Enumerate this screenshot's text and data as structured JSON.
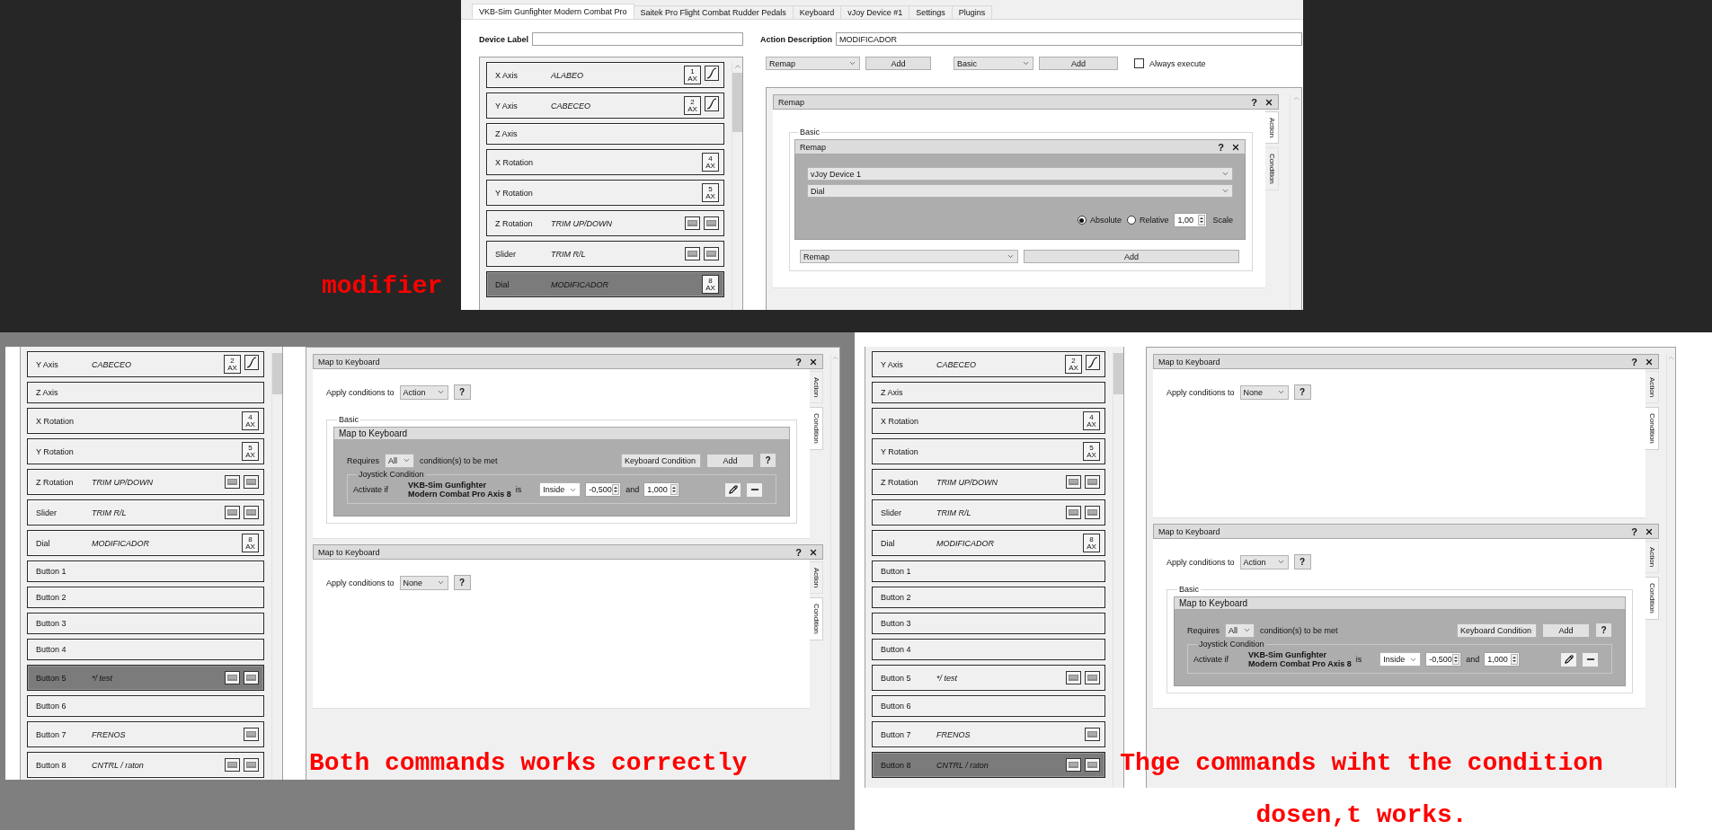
{
  "top_screenshot": {
    "tabs": [
      {
        "label": "VKB-Sim Gunfighter Modern Combat Pro",
        "selected": true
      },
      {
        "label": "Saitek Pro Flight Combat Rudder Pedals",
        "selected": false
      },
      {
        "label": "Keyboard",
        "selected": false
      },
      {
        "label": "vJoy Device #1",
        "selected": false
      },
      {
        "label": "Settings",
        "selected": false
      },
      {
        "label": "Plugins",
        "selected": false
      }
    ],
    "device_label": {
      "label": "Device Label"
    },
    "action_description": {
      "label": "Action Description",
      "value": "MODIFICADOR"
    },
    "inputs": [
      {
        "name": "X Axis",
        "description": "ALABEO",
        "selected": false,
        "badges": [
          {
            "kind": "axis",
            "number": "1",
            "unit": "AX"
          },
          {
            "kind": "curve"
          }
        ]
      },
      {
        "name": "Y Axis",
        "description": "CABECEO",
        "selected": false,
        "badges": [
          {
            "kind": "axis",
            "number": "2",
            "unit": "AX"
          },
          {
            "kind": "curve"
          }
        ]
      },
      {
        "name": "Z Axis",
        "selected": false
      },
      {
        "name": "X Rotation",
        "selected": false,
        "badges": [
          {
            "kind": "axis",
            "number": "4",
            "unit": "AX"
          }
        ]
      },
      {
        "name": "Y Rotation",
        "selected": false,
        "badges": [
          {
            "kind": "axis",
            "number": "5",
            "unit": "AX"
          }
        ]
      },
      {
        "name": "Z Rotation",
        "description": "TRIM UP/DOWN",
        "selected": false,
        "badges": [
          {
            "kind": "keyboard"
          },
          {
            "kind": "keyboard"
          }
        ]
      },
      {
        "name": "Slider",
        "description": "TRIM R/L",
        "selected": false,
        "badges": [
          {
            "kind": "keyboard"
          },
          {
            "kind": "keyboard"
          }
        ]
      },
      {
        "name": "Dial",
        "description": "MODIFICADOR",
        "selected": true,
        "badges": [
          {
            "kind": "axis",
            "number": "8",
            "unit": "AX"
          }
        ]
      }
    ],
    "toolbar": {
      "action_type": "Remap",
      "add_action": "Add",
      "container_type": "Basic",
      "add_container": "Add",
      "always_execute": {
        "label": "Always execute",
        "checked": false
      }
    },
    "editor": {
      "title": "Remap",
      "help": "?",
      "side_tabs": [
        {
          "label": "Action",
          "selected": true
        },
        {
          "label": "Condition",
          "selected": false
        }
      ],
      "group": "Basic",
      "remap": {
        "title": "Remap",
        "help": "?",
        "device": "vJoy Device 1",
        "axis": "Dial",
        "modes": [
          {
            "label": "Absolute",
            "selected": true
          },
          {
            "label": "Relative",
            "selected": false
          }
        ],
        "scale": "1,00",
        "scale_label": "Scale"
      },
      "add_type": "Remap",
      "add": "Add"
    }
  },
  "top_caption": [
    "modifier"
  ],
  "bottom_left": {
    "inputs": [
      {
        "name": "Y Axis",
        "description": "CABECEO",
        "selected": false,
        "badges": [
          {
            "kind": "axis",
            "number": "2",
            "unit": "AX"
          },
          {
            "kind": "curve"
          }
        ]
      },
      {
        "name": "Z Axis",
        "selected": false
      },
      {
        "name": "X Rotation",
        "selected": false,
        "badges": [
          {
            "kind": "axis",
            "number": "4",
            "unit": "AX"
          }
        ]
      },
      {
        "name": "Y Rotation",
        "selected": false,
        "badges": [
          {
            "kind": "axis",
            "number": "5",
            "unit": "AX"
          }
        ]
      },
      {
        "name": "Z Rotation",
        "description": "TRIM UP/DOWN",
        "selected": false,
        "badges": [
          {
            "kind": "keyboard"
          },
          {
            "kind": "keyboard"
          }
        ]
      },
      {
        "name": "Slider",
        "description": "TRIM R/L",
        "selected": false,
        "badges": [
          {
            "kind": "keyboard"
          },
          {
            "kind": "keyboard"
          }
        ]
      },
      {
        "name": "Dial",
        "description": "MODIFICADOR",
        "selected": false,
        "badges": [
          {
            "kind": "axis",
            "number": "8",
            "unit": "AX"
          }
        ]
      },
      {
        "name": "Button 1",
        "selected": false
      },
      {
        "name": "Button 2",
        "selected": false
      },
      {
        "name": "Button 3",
        "selected": false
      },
      {
        "name": "Button 4",
        "selected": false
      },
      {
        "name": "Button 5",
        "description": "*/ test",
        "selected": true,
        "badges": [
          {
            "kind": "keyboard"
          },
          {
            "kind": "keyboard"
          }
        ]
      },
      {
        "name": "Button 6",
        "selected": false
      },
      {
        "name": "Button 7",
        "description": "FRENOS",
        "selected": false,
        "badges": [
          {
            "kind": "keyboard"
          }
        ]
      },
      {
        "name": "Button 8",
        "description": "CNTRL / raton",
        "selected": false,
        "badges": [
          {
            "kind": "keyboard"
          },
          {
            "kind": "keyboard"
          }
        ]
      }
    ],
    "actions": [
      {
        "title": "Map to Keyboard",
        "help": "?",
        "side_tabs": [
          {
            "label": "Action",
            "selected": false
          },
          {
            "label": "Condition",
            "selected": true
          }
        ],
        "apply": {
          "label": "Apply conditions to",
          "value": "Action",
          "help": "?"
        },
        "conditions": {
          "group": "Basic",
          "title": "Map to Keyboard",
          "requires_label": "Requires",
          "requires": "All",
          "requires_suffix": "condition(s) to be met",
          "condition_type": "Keyboard Condition",
          "add": "Add",
          "help": "?",
          "joystick": {
            "title": "Joystick Condition",
            "activate_label": "Activate if",
            "input": [
              "VKB-Sim Gunfighter",
              "Modern Combat Pro Axis 8"
            ],
            "is": "is",
            "comparison": "Inside",
            "lower": "-0,500",
            "and": "and",
            "upper": "1,000"
          }
        }
      },
      {
        "title": "Map to Keyboard",
        "help": "?",
        "side_tabs": [
          {
            "label": "Action",
            "selected": false
          },
          {
            "label": "Condition",
            "selected": true
          }
        ],
        "apply": {
          "label": "Apply conditions to",
          "value": "None",
          "help": "?"
        }
      }
    ],
    "caption": [
      "Both commands works correctly"
    ]
  },
  "bottom_right": {
    "inputs": [
      {
        "name": "Y Axis",
        "description": "CABECEO",
        "selected": false,
        "badges": [
          {
            "kind": "axis",
            "number": "2",
            "unit": "AX"
          },
          {
            "kind": "curve"
          }
        ]
      },
      {
        "name": "Z Axis",
        "selected": false
      },
      {
        "name": "X Rotation",
        "selected": false,
        "badges": [
          {
            "kind": "axis",
            "number": "4",
            "unit": "AX"
          }
        ]
      },
      {
        "name": "Y Rotation",
        "selected": false,
        "badges": [
          {
            "kind": "axis",
            "number": "5",
            "unit": "AX"
          }
        ]
      },
      {
        "name": "Z Rotation",
        "description": "TRIM UP/DOWN",
        "selected": false,
        "badges": [
          {
            "kind": "keyboard"
          },
          {
            "kind": "keyboard"
          }
        ]
      },
      {
        "name": "Slider",
        "description": "TRIM R/L",
        "selected": false,
        "badges": [
          {
            "kind": "keyboard"
          },
          {
            "kind": "keyboard"
          }
        ]
      },
      {
        "name": "Dial",
        "description": "MODIFICADOR",
        "selected": false,
        "badges": [
          {
            "kind": "axis",
            "number": "8",
            "unit": "AX"
          }
        ]
      },
      {
        "name": "Button 1",
        "selected": false
      },
      {
        "name": "Button 2",
        "selected": false
      },
      {
        "name": "Button 3",
        "selected": false
      },
      {
        "name": "Button 4",
        "selected": false
      },
      {
        "name": "Button 5",
        "description": "*/ test",
        "selected": false,
        "badges": [
          {
            "kind": "keyboard"
          },
          {
            "kind": "keyboard"
          }
        ]
      },
      {
        "name": "Button 6",
        "selected": false
      },
      {
        "name": "Button 7",
        "description": "FRENOS",
        "selected": false,
        "badges": [
          {
            "kind": "keyboard"
          }
        ]
      },
      {
        "name": "Button 8",
        "description": "CNTRL / raton",
        "selected": true,
        "badges": [
          {
            "kind": "keyboard"
          },
          {
            "kind": "keyboard"
          }
        ]
      }
    ],
    "actions": [
      {
        "title": "Map to Keyboard",
        "help": "?",
        "side_tabs": [
          {
            "label": "Action",
            "selected": false
          },
          {
            "label": "Condition",
            "selected": true
          }
        ],
        "apply": {
          "label": "Apply conditions to",
          "value": "None",
          "help": "?"
        }
      },
      {
        "title": "Map to Keyboard",
        "help": "?",
        "side_tabs": [
          {
            "label": "Action",
            "selected": false
          },
          {
            "label": "Condition",
            "selected": true
          }
        ],
        "apply": {
          "label": "Apply conditions to",
          "value": "Action",
          "help": "?"
        },
        "conditions": {
          "group": "Basic",
          "title": "Map to Keyboard",
          "requires_label": "Requires",
          "requires": "All",
          "requires_suffix": "condition(s) to be met",
          "condition_type": "Keyboard Condition",
          "add": "Add",
          "help": "?",
          "joystick": {
            "title": "Joystick Condition",
            "activate_label": "Activate if",
            "input": [
              "VKB-Sim Gunfighter",
              "Modern Combat Pro Axis 8"
            ],
            "is": "is",
            "comparison": "Inside",
            "lower": "-0,500",
            "and": "and",
            "upper": "1,000"
          }
        }
      }
    ],
    "caption": [
      "Thge commands wiht the condition",
      "dosen,t works."
    ]
  }
}
